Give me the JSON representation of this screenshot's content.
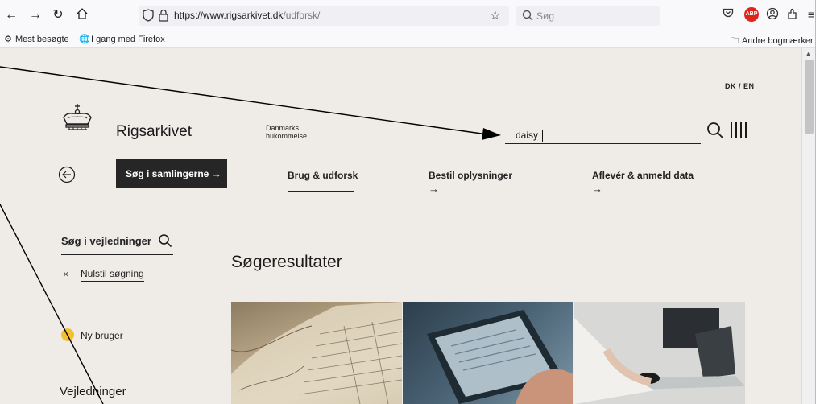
{
  "browser": {
    "url_host": "https://www.rigsarkivet.dk",
    "url_path": "/udforsk/",
    "search_placeholder": "Søg",
    "bookmarks": [
      "Mest besøgte",
      "I gang med Firefox"
    ],
    "other_bookmarks": "Andre bogmærker",
    "abp_label": "ABP",
    "icons": [
      "back-icon",
      "forward-icon",
      "reload-icon",
      "home-icon",
      "tracking-shield-icon",
      "lock-icon",
      "bookmark-star-icon",
      "search-icon",
      "pocket-icon",
      "adblock-icon",
      "account-icon",
      "extensions-icon",
      "hamburger-menu-icon"
    ]
  },
  "site": {
    "language_switch": "DK / EN",
    "brand": "Rigsarkivet",
    "tagline_line1": "Danmarks",
    "tagline_line2": "hukommelse",
    "search_value": "daisy",
    "cta_label": "Søg i samlingerne →",
    "nav": [
      {
        "label": "Brug & udforsk"
      },
      {
        "label": "Bestil oplysninger"
      },
      {
        "label": "Aflevér & anmeld data"
      }
    ],
    "nav_arrow": "→",
    "sidebar": {
      "search_label": "Søg i vejledninger",
      "clear_label": "Nulstil søgning",
      "clear_icon": "×",
      "new_user": "Ny bruger",
      "guides_heading": "Vejledninger"
    },
    "results_heading": "Søgeresultater",
    "accent_yellow": "#f5bf2e",
    "page_bg": "#efece7"
  }
}
